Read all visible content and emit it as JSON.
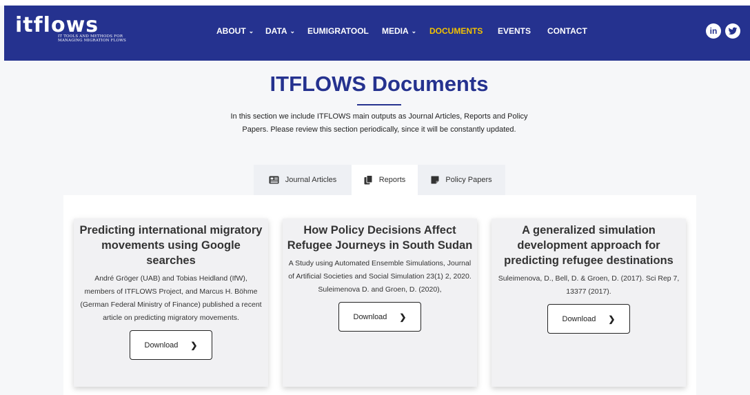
{
  "brand": {
    "logo_text": "itflows",
    "tagline": "IT TOOLS AND METHODS FOR MANAGING MIGRATION FLOWS",
    "primary_color": "#25328f",
    "active_color": "#f2c200"
  },
  "nav": {
    "items": [
      {
        "label": "ABOUT",
        "dropdown": true
      },
      {
        "label": "DATA",
        "dropdown": true
      },
      {
        "label": "EUMIGRATOOL",
        "dropdown": false
      },
      {
        "label": "MEDIA",
        "dropdown": true
      },
      {
        "label": "DOCUMENTS",
        "dropdown": false,
        "active": true
      },
      {
        "label": "EVENTS",
        "dropdown": false
      },
      {
        "label": "CONTACT",
        "dropdown": false
      }
    ],
    "social": {
      "linkedin_label": "in",
      "twitter_icon": "twitter-icon"
    }
  },
  "page": {
    "title": "ITFLOWS Documents",
    "intro": "In this section we include ITFLOWS main outputs as Journal Articles, Reports and Policy Papers. Please review this section periodically, since it will be constantly updated."
  },
  "tabs": [
    {
      "label": "Journal Articles",
      "icon": "newspaper-icon"
    },
    {
      "label": "Reports",
      "icon": "copy-documents-icon",
      "active": true
    },
    {
      "label": "Policy Papers",
      "icon": "sticky-note-icon"
    }
  ],
  "cards": [
    {
      "title": "Predicting international migratory movements using Google searches",
      "description": "André Gröger (UAB) and Tobias Heidland (IfW), members of ITFLOWS Project, and Marcus H. Böhme (German Federal Ministry of Finance) published a recent article on predicting migratory movements.",
      "button": "Download"
    },
    {
      "title": "How Policy Decisions Affect Refugee Journeys in South Sudan",
      "description": "A Study using Automated Ensemble Simulations, Journal of Artificial Societies and Social Simulation 23(1) 2, 2020. Suleimenova D. and Groen, D. (2020),",
      "button": "Download"
    },
    {
      "title": "A generalized simulation development approach for predicting refugee destinations",
      "description": "Suleimenova, D., Bell, D. & Groen, D. (2017). Sci Rep 7, 13377 (2017).",
      "button": "Download"
    }
  ]
}
